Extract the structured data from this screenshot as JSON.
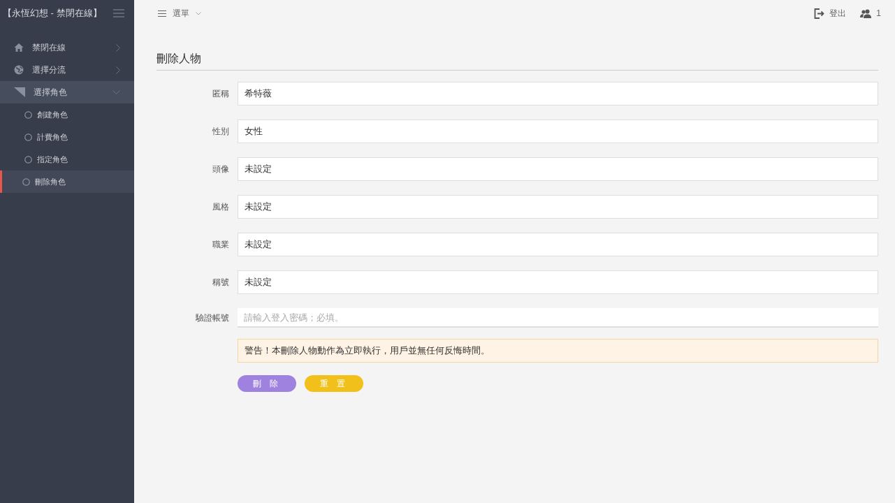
{
  "sidebar": {
    "title": "【永恆幻想 - 禁閉在線】",
    "items": [
      {
        "label": "禁閉在線",
        "expanded": false
      },
      {
        "label": "選擇分流",
        "expanded": false
      },
      {
        "label": "選擇角色",
        "expanded": true,
        "children": [
          {
            "label": "創建角色",
            "selected": false
          },
          {
            "label": "計費角色",
            "selected": false
          },
          {
            "label": "指定角色",
            "selected": false
          },
          {
            "label": "刪除角色",
            "selected": true
          }
        ]
      }
    ]
  },
  "topbar": {
    "menu": "選單",
    "logout": "登出",
    "users": "1"
  },
  "form": {
    "title": "刪除人物",
    "fields": [
      {
        "label": "匿稱",
        "kind": "display",
        "value": "希特薇"
      },
      {
        "label": "性別",
        "kind": "display",
        "value": "女性"
      },
      {
        "label": "頭像",
        "kind": "display",
        "value": "未設定"
      },
      {
        "label": "風格",
        "kind": "display",
        "value": "未設定"
      },
      {
        "label": "職業",
        "kind": "display",
        "value": "未設定"
      },
      {
        "label": "稱號",
        "kind": "display",
        "value": "未設定"
      },
      {
        "label": "驗證帳號",
        "kind": "input",
        "placeholder": "請輸入登入密碼；必填。"
      }
    ],
    "warning": "警告！本刪除人物動作為立即執行，用戶並無任何反悔時間。",
    "buttons": [
      {
        "label": "刪 除",
        "kind": "danger"
      },
      {
        "label": "重 置",
        "kind": "reset"
      }
    ]
  }
}
